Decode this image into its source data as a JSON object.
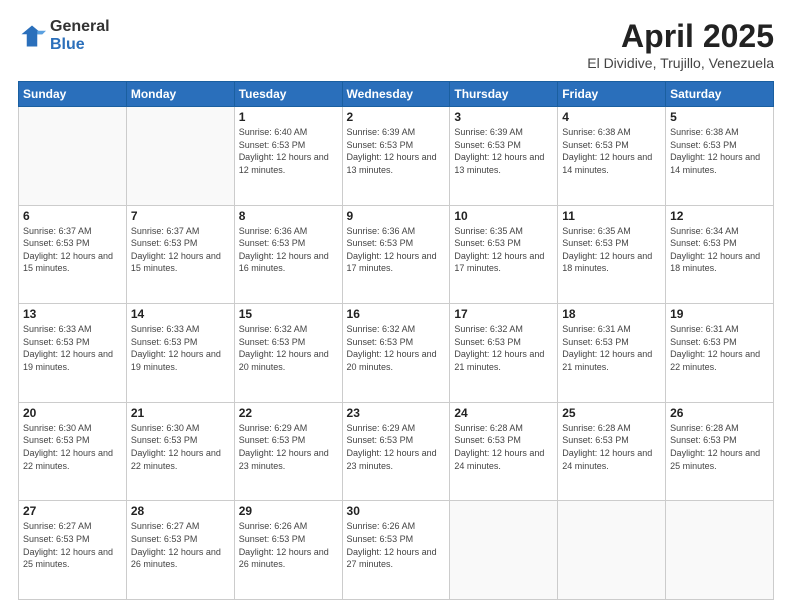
{
  "logo": {
    "general": "General",
    "blue": "Blue"
  },
  "title": {
    "month": "April 2025",
    "location": "El Dividive, Trujillo, Venezuela"
  },
  "headers": [
    "Sunday",
    "Monday",
    "Tuesday",
    "Wednesday",
    "Thursday",
    "Friday",
    "Saturday"
  ],
  "weeks": [
    [
      {
        "day": "",
        "info": ""
      },
      {
        "day": "",
        "info": ""
      },
      {
        "day": "1",
        "info": "Sunrise: 6:40 AM\nSunset: 6:53 PM\nDaylight: 12 hours and 12 minutes."
      },
      {
        "day": "2",
        "info": "Sunrise: 6:39 AM\nSunset: 6:53 PM\nDaylight: 12 hours and 13 minutes."
      },
      {
        "day": "3",
        "info": "Sunrise: 6:39 AM\nSunset: 6:53 PM\nDaylight: 12 hours and 13 minutes."
      },
      {
        "day": "4",
        "info": "Sunrise: 6:38 AM\nSunset: 6:53 PM\nDaylight: 12 hours and 14 minutes."
      },
      {
        "day": "5",
        "info": "Sunrise: 6:38 AM\nSunset: 6:53 PM\nDaylight: 12 hours and 14 minutes."
      }
    ],
    [
      {
        "day": "6",
        "info": "Sunrise: 6:37 AM\nSunset: 6:53 PM\nDaylight: 12 hours and 15 minutes."
      },
      {
        "day": "7",
        "info": "Sunrise: 6:37 AM\nSunset: 6:53 PM\nDaylight: 12 hours and 15 minutes."
      },
      {
        "day": "8",
        "info": "Sunrise: 6:36 AM\nSunset: 6:53 PM\nDaylight: 12 hours and 16 minutes."
      },
      {
        "day": "9",
        "info": "Sunrise: 6:36 AM\nSunset: 6:53 PM\nDaylight: 12 hours and 17 minutes."
      },
      {
        "day": "10",
        "info": "Sunrise: 6:35 AM\nSunset: 6:53 PM\nDaylight: 12 hours and 17 minutes."
      },
      {
        "day": "11",
        "info": "Sunrise: 6:35 AM\nSunset: 6:53 PM\nDaylight: 12 hours and 18 minutes."
      },
      {
        "day": "12",
        "info": "Sunrise: 6:34 AM\nSunset: 6:53 PM\nDaylight: 12 hours and 18 minutes."
      }
    ],
    [
      {
        "day": "13",
        "info": "Sunrise: 6:33 AM\nSunset: 6:53 PM\nDaylight: 12 hours and 19 minutes."
      },
      {
        "day": "14",
        "info": "Sunrise: 6:33 AM\nSunset: 6:53 PM\nDaylight: 12 hours and 19 minutes."
      },
      {
        "day": "15",
        "info": "Sunrise: 6:32 AM\nSunset: 6:53 PM\nDaylight: 12 hours and 20 minutes."
      },
      {
        "day": "16",
        "info": "Sunrise: 6:32 AM\nSunset: 6:53 PM\nDaylight: 12 hours and 20 minutes."
      },
      {
        "day": "17",
        "info": "Sunrise: 6:32 AM\nSunset: 6:53 PM\nDaylight: 12 hours and 21 minutes."
      },
      {
        "day": "18",
        "info": "Sunrise: 6:31 AM\nSunset: 6:53 PM\nDaylight: 12 hours and 21 minutes."
      },
      {
        "day": "19",
        "info": "Sunrise: 6:31 AM\nSunset: 6:53 PM\nDaylight: 12 hours and 22 minutes."
      }
    ],
    [
      {
        "day": "20",
        "info": "Sunrise: 6:30 AM\nSunset: 6:53 PM\nDaylight: 12 hours and 22 minutes."
      },
      {
        "day": "21",
        "info": "Sunrise: 6:30 AM\nSunset: 6:53 PM\nDaylight: 12 hours and 22 minutes."
      },
      {
        "day": "22",
        "info": "Sunrise: 6:29 AM\nSunset: 6:53 PM\nDaylight: 12 hours and 23 minutes."
      },
      {
        "day": "23",
        "info": "Sunrise: 6:29 AM\nSunset: 6:53 PM\nDaylight: 12 hours and 23 minutes."
      },
      {
        "day": "24",
        "info": "Sunrise: 6:28 AM\nSunset: 6:53 PM\nDaylight: 12 hours and 24 minutes."
      },
      {
        "day": "25",
        "info": "Sunrise: 6:28 AM\nSunset: 6:53 PM\nDaylight: 12 hours and 24 minutes."
      },
      {
        "day": "26",
        "info": "Sunrise: 6:28 AM\nSunset: 6:53 PM\nDaylight: 12 hours and 25 minutes."
      }
    ],
    [
      {
        "day": "27",
        "info": "Sunrise: 6:27 AM\nSunset: 6:53 PM\nDaylight: 12 hours and 25 minutes."
      },
      {
        "day": "28",
        "info": "Sunrise: 6:27 AM\nSunset: 6:53 PM\nDaylight: 12 hours and 26 minutes."
      },
      {
        "day": "29",
        "info": "Sunrise: 6:26 AM\nSunset: 6:53 PM\nDaylight: 12 hours and 26 minutes."
      },
      {
        "day": "30",
        "info": "Sunrise: 6:26 AM\nSunset: 6:53 PM\nDaylight: 12 hours and 27 minutes."
      },
      {
        "day": "",
        "info": ""
      },
      {
        "day": "",
        "info": ""
      },
      {
        "day": "",
        "info": ""
      }
    ]
  ]
}
